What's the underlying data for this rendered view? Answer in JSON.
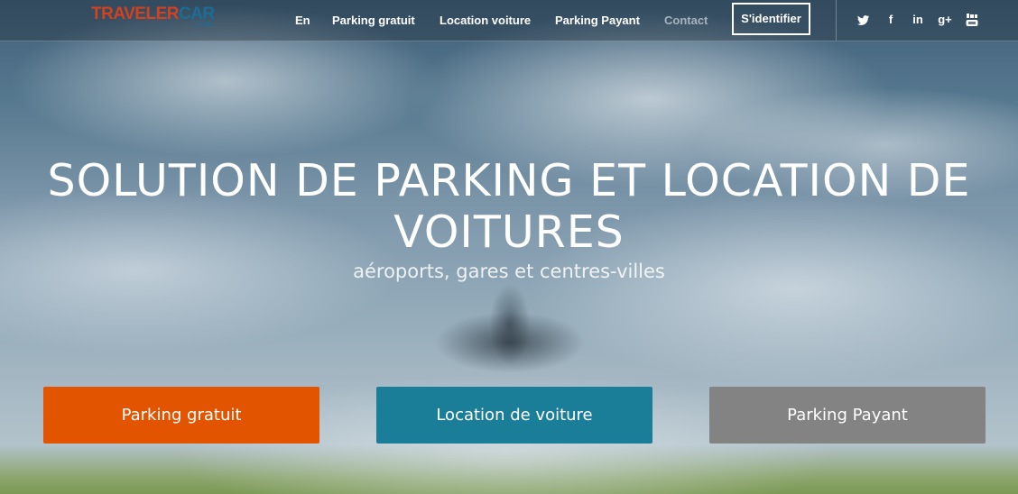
{
  "header": {
    "logo": {
      "brand_part1": "TRAVELER",
      "brand_part2": "CAR",
      "domain": ".com"
    },
    "nav": {
      "lang": "En",
      "parking_gratuit": "Parking gratuit",
      "location_voiture": "Location voiture",
      "parking_payant": "Parking Payant",
      "contact": "Contact",
      "login": "S'identifier"
    },
    "social": {
      "twitter": "twitter-icon",
      "facebook": "f",
      "linkedin": "in",
      "googleplus": "g+",
      "youtube": "youtube-icon"
    }
  },
  "hero": {
    "title_line1": "SOLUTION DE PARKING ET LOCATION DE",
    "title_line2": "VOITURES",
    "subtitle": "aéroports, gares et centres-villes"
  },
  "cta": {
    "parking_gratuit": "Parking gratuit",
    "location_voiture": "Location de voiture",
    "parking_payant": "Parking Payant"
  },
  "colors": {
    "orange": "#e25400",
    "teal": "#1b7e99",
    "gray": "#838383",
    "logo_red": "#d3411e",
    "logo_blue": "#1b6d96"
  }
}
